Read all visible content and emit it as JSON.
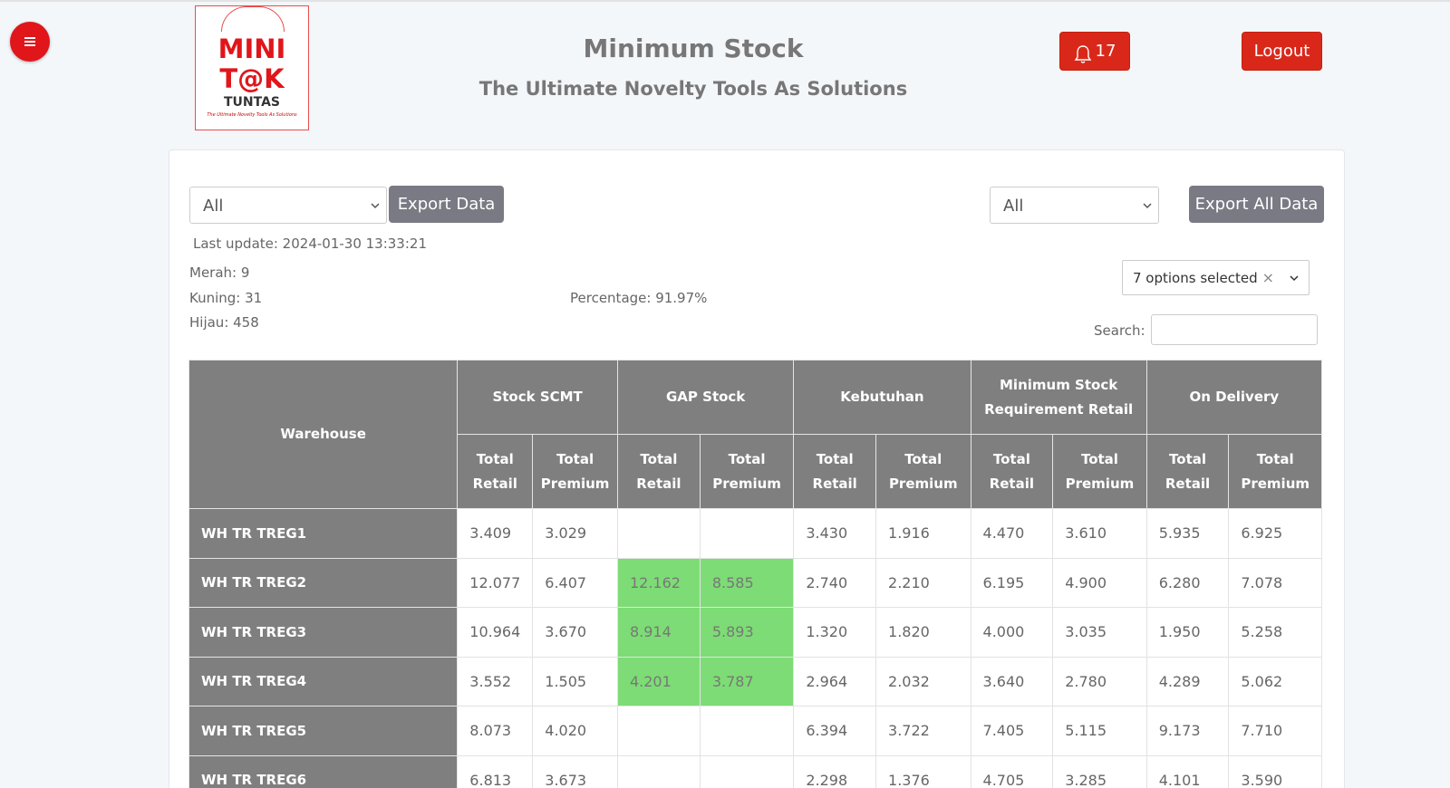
{
  "header": {
    "menu_icon": "hamburger-icon",
    "logo": {
      "line1": "MINI",
      "line2": "T@K",
      "line3": "TUNTAS",
      "tagline": "The Ultimate Novelty Tools As Solutions"
    },
    "title": "Minimum Stock",
    "subtitle": "The Ultimate Novelty Tools As Solutions",
    "notifications_count": "17",
    "notification_icon": "bell-icon",
    "logout_label": "Logout"
  },
  "filters": {
    "left_select_value": "All",
    "export_data_label": "Export Data",
    "right_select_value": "All",
    "export_all_label": "Export All Data",
    "multiselect_value": "7 options selected",
    "multiselect_clear": "×",
    "search_label": "Search:",
    "search_value": ""
  },
  "summary": {
    "last_update": "Last update: 2024-01-30 13:33:21",
    "merah": "Merah: 9",
    "kuning": "Kuning: 31",
    "hijau": "Hijau: 458",
    "percentage": "Percentage: 91.97%"
  },
  "table": {
    "warehouse_header": "Warehouse",
    "groups": [
      "Stock SCMT",
      "GAP Stock",
      "Kebutuhan",
      "Minimum Stock Requirement Retail",
      "On Delivery"
    ],
    "sub_retail": "Total Retail",
    "sub_premium": "Total Premium",
    "rows": [
      {
        "name": "WH TR TREG1",
        "cells": [
          "3.409",
          "3.029",
          "",
          "",
          "3.430",
          "1.916",
          "4.470",
          "3.610",
          "5.935",
          "6.925"
        ],
        "gap_highlight": false
      },
      {
        "name": "WH TR TREG2",
        "cells": [
          "12.077",
          "6.407",
          "12.162",
          "8.585",
          "2.740",
          "2.210",
          "6.195",
          "4.900",
          "6.280",
          "7.078"
        ],
        "gap_highlight": true
      },
      {
        "name": "WH TR TREG3",
        "cells": [
          "10.964",
          "3.670",
          "8.914",
          "5.893",
          "1.320",
          "1.820",
          "4.000",
          "3.035",
          "1.950",
          "5.258"
        ],
        "gap_highlight": true
      },
      {
        "name": "WH TR TREG4",
        "cells": [
          "3.552",
          "1.505",
          "4.201",
          "3.787",
          "2.964",
          "2.032",
          "3.640",
          "2.780",
          "4.289",
          "5.062"
        ],
        "gap_highlight": true
      },
      {
        "name": "WH TR TREG5",
        "cells": [
          "8.073",
          "4.020",
          "",
          "",
          "6.394",
          "3.722",
          "7.405",
          "5.115",
          "9.173",
          "7.710"
        ],
        "gap_highlight": false
      },
      {
        "name": "WH TR TREG6",
        "cells": [
          "6.813",
          "3.673",
          "",
          "",
          "2.298",
          "1.376",
          "4.705",
          "3.285",
          "4.101",
          "3.590"
        ],
        "gap_highlight": false
      }
    ]
  },
  "colors": {
    "accent_red": "#d9281a",
    "header_gray": "#7f7f7f",
    "gap_green": "#7ddc75",
    "button_gray": "#7a7a85"
  }
}
